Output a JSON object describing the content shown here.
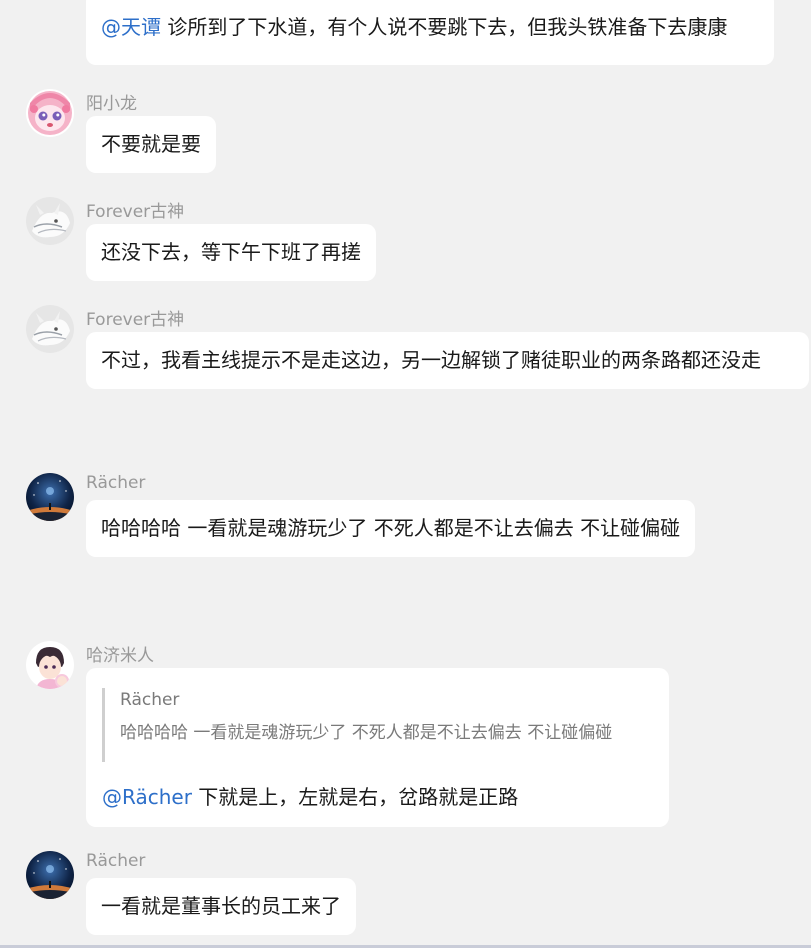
{
  "messages": [
    {
      "id": "m0",
      "sender": "",
      "mention": "@天谭",
      "text": " 诊所到了下水道，有个人说不要跳下去，但我头铁准备下去康康"
    },
    {
      "id": "m1",
      "sender": "阳小龙",
      "avatar": "pink-anime-girl-avatar",
      "text": "不要就是要"
    },
    {
      "id": "m2",
      "sender": "Forever古神",
      "avatar": "white-creature-avatar",
      "text": "还没下去，等下午下班了再搓"
    },
    {
      "id": "m3",
      "sender": "Forever古神",
      "avatar": "white-creature-avatar",
      "text": "不过，我看主线提示不是走这边，另一边解锁了赌徒职业的两条路都还没走"
    },
    {
      "id": "m4",
      "sender": "Rächer",
      "avatar": "night-sky-avatar",
      "text": "哈哈哈哈 一看就是魂游玩少了 不死人都是不让去偏去 不让碰偏碰"
    },
    {
      "id": "m5",
      "sender": "哈济米人",
      "avatar": "anime-boy-avatar",
      "quote": {
        "sender": "Rächer",
        "text": "哈哈哈哈 一看就是魂游玩少了 不死人都是不让去偏去 不让碰偏碰"
      },
      "mention": "@Rächer",
      "text": " 下就是上，左就是右，岔路就是正路"
    },
    {
      "id": "m6",
      "sender": "Rächer",
      "avatar": "night-sky-avatar",
      "text": "一看就是董事长的员工来了"
    }
  ]
}
